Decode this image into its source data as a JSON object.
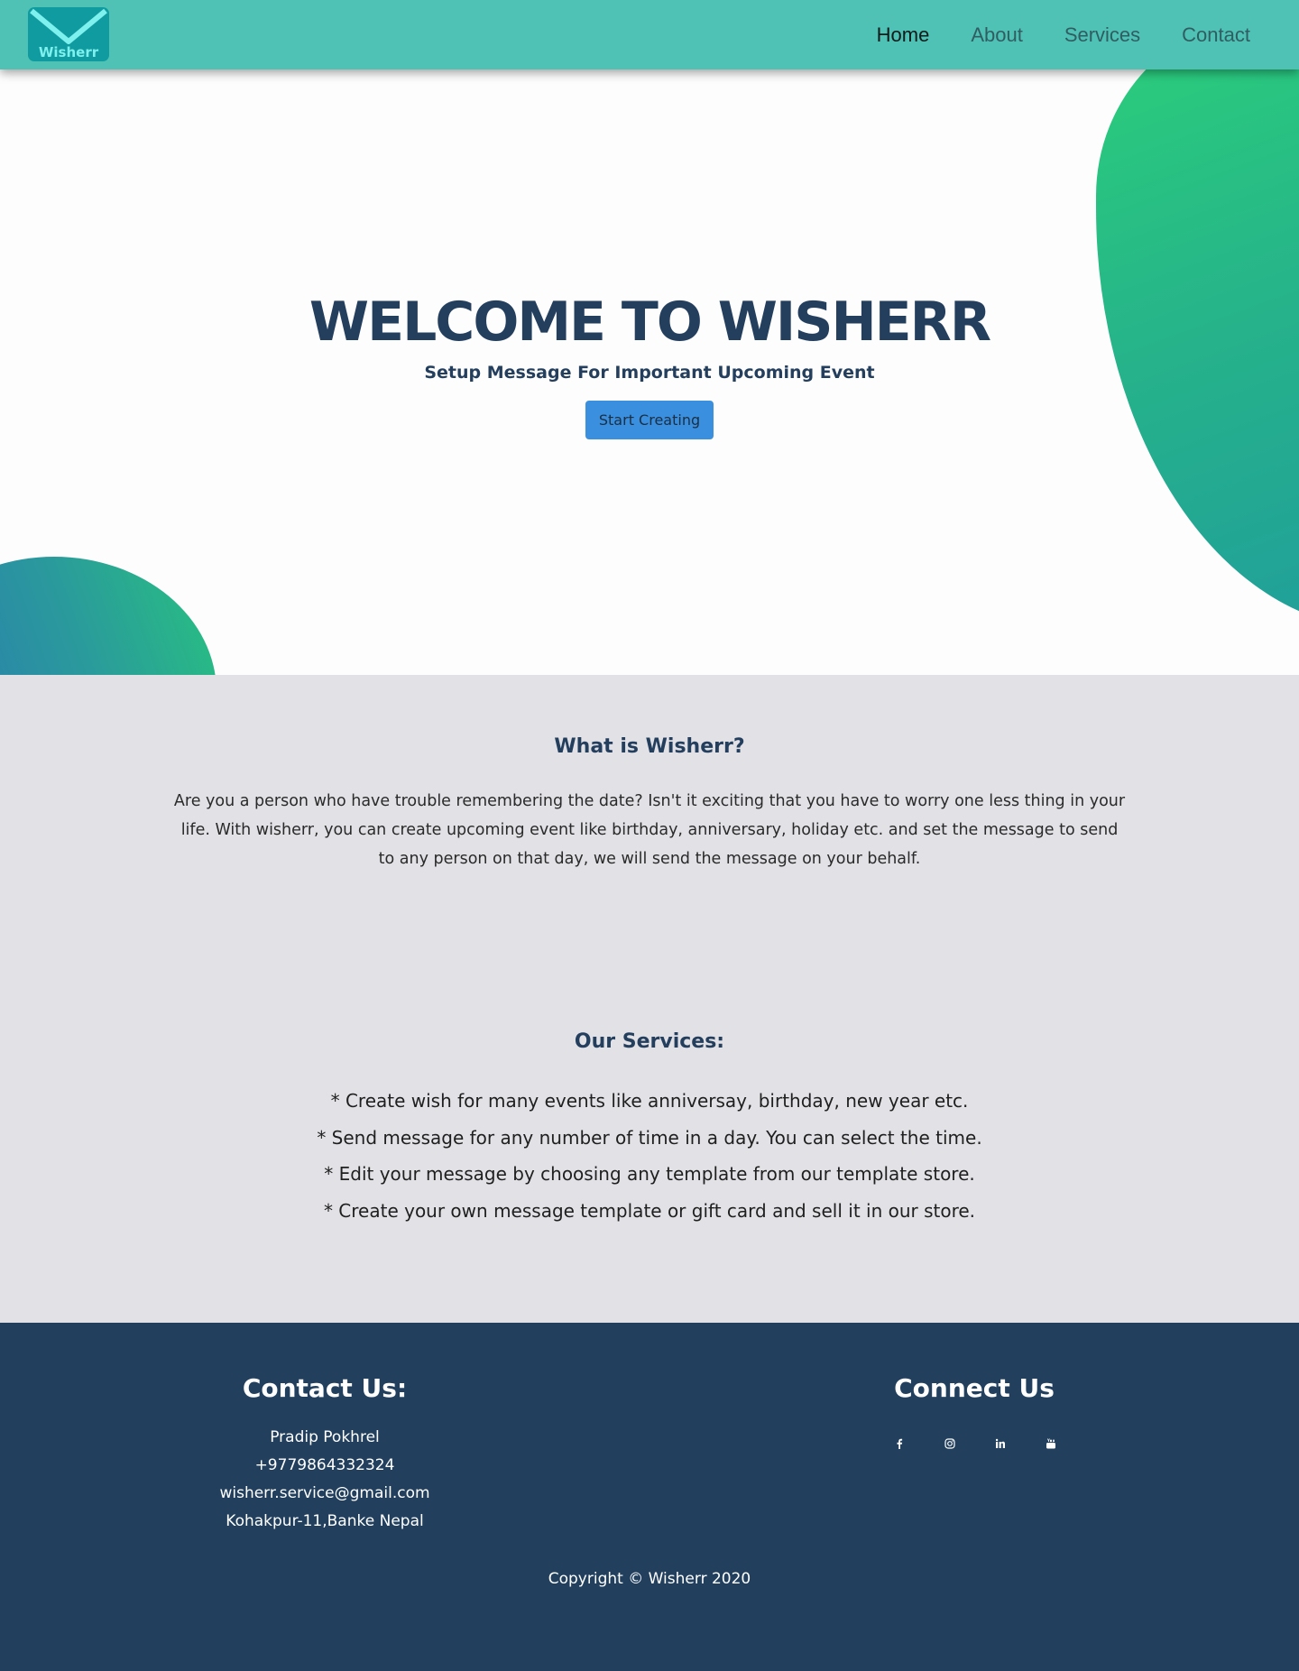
{
  "brand": {
    "logo_text": "Wisherr"
  },
  "nav": {
    "items": [
      {
        "label": "Home",
        "active": true
      },
      {
        "label": "About",
        "active": false
      },
      {
        "label": "Services",
        "active": false
      },
      {
        "label": "Contact",
        "active": false
      }
    ]
  },
  "hero": {
    "title": "WELCOME TO WISHERR",
    "subtitle": "Setup Message For Important Upcoming Event",
    "cta_label": "Start Creating"
  },
  "about": {
    "title": "What is Wisherr?",
    "text": "Are you a person who have trouble remembering the date? Isn't it exciting that you have to worry one less thing in your life. With wisherr, you can create upcoming event like birthday, anniversary, holiday etc. and set the message to send to any person on that day, we will send the message on your behalf."
  },
  "services": {
    "title": "Our Services:",
    "items": [
      "* Create wish for many events like anniversay, birthday, new year etc.",
      "* Send message for any number of time in a day. You can select the time.",
      "* Edit your message by choosing any template from our template store.",
      "* Create your own message template or gift card and sell it in our store."
    ]
  },
  "footer": {
    "contact_title": "Contact Us:",
    "contact_lines": [
      "Pradip Pokhrel",
      "+9779864332324",
      "wisherr.service@gmail.com",
      "Kohakpur-11,Banke Nepal"
    ],
    "connect_title": "Connect Us",
    "social_icons": [
      "facebook-icon",
      "instagram-icon",
      "linkedin-icon",
      "youtube-icon"
    ],
    "copyright": "Copyright © Wisherr 2020"
  },
  "colors": {
    "navbar": "#4fc2b5",
    "heading": "#243f5e",
    "cta": "#3a8fde",
    "section_bg": "#e2e1e6",
    "footer_bg": "#22405e"
  }
}
